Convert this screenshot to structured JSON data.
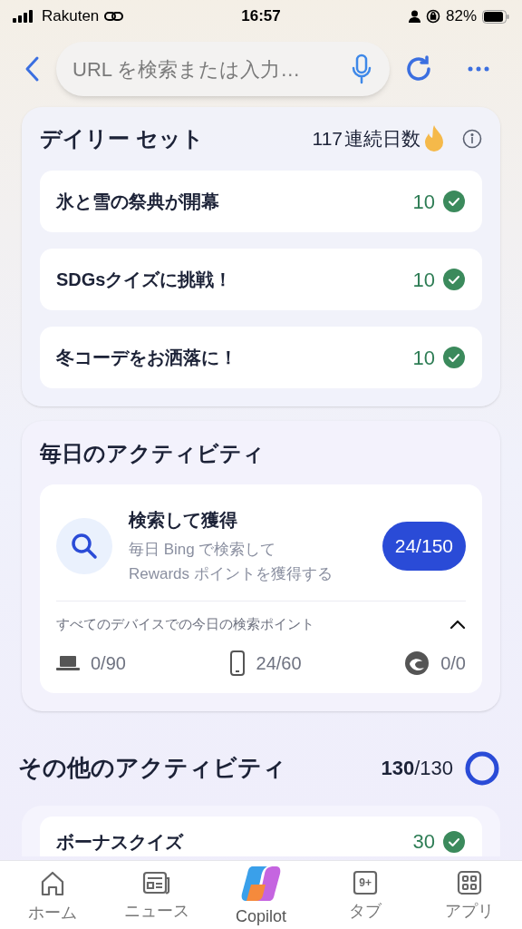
{
  "status_bar": {
    "carrier": "Rakuten",
    "time": "16:57",
    "battery": "82%"
  },
  "toolbar": {
    "search": {
      "placeholder": "URL を検索または入力…"
    }
  },
  "daily_set": {
    "title": "デイリー セット",
    "streak": "117",
    "streak_label": "連続日数",
    "items": [
      {
        "label": "氷と雪の祭典が開幕",
        "points": "10",
        "completed": true
      },
      {
        "label": "SDGsクイズに挑戦！",
        "points": "10",
        "completed": true
      },
      {
        "label": "冬コーデをお洒落に！",
        "points": "10",
        "completed": true
      }
    ]
  },
  "daily_activity": {
    "title": "毎日のアクティビティ",
    "search_card": {
      "title": "検索して獲得",
      "description": "毎日 Bing で検索して\nRewards ポイントを獲得する",
      "progress": "24/150",
      "breakdown_title": "すべてのデバイスでの今日の検索ポイント",
      "expanded": true,
      "devices": [
        {
          "kind": "laptop",
          "value": "0/90"
        },
        {
          "kind": "phone",
          "value": "24/60"
        },
        {
          "kind": "edge",
          "value": "0/0"
        }
      ]
    }
  },
  "other_activities": {
    "title": "その他のアクティビティ",
    "earned": "130",
    "total": "/130",
    "level": 1,
    "items": [
      {
        "label": "ボーナスクイズ",
        "points": "30",
        "completed": true
      }
    ]
  },
  "bottom_nav": [
    {
      "kind": "home",
      "label": "ホーム"
    },
    {
      "kind": "news",
      "label": "ニュース"
    },
    {
      "kind": "copilot",
      "label": "Copilot"
    },
    {
      "kind": "tabs",
      "label": "タブ",
      "count": "9+"
    },
    {
      "kind": "apps",
      "label": "アプリ"
    }
  ]
}
